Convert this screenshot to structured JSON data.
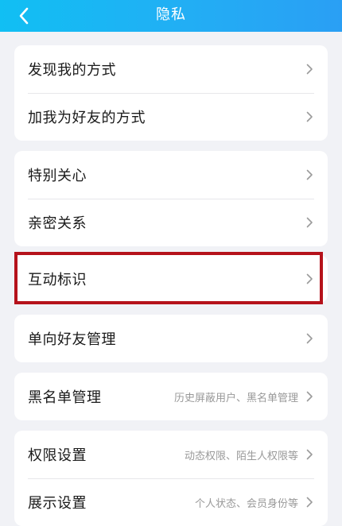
{
  "header": {
    "title": "隐私",
    "back_icon": "chevron-left-icon"
  },
  "groups": [
    {
      "items": [
        {
          "label": "发现我的方式"
        },
        {
          "label": "加我为好友的方式"
        }
      ]
    },
    {
      "items": [
        {
          "label": "特别关心"
        },
        {
          "label": "亲密关系"
        }
      ]
    },
    {
      "items": [
        {
          "label": "互动标识",
          "highlighted": true
        }
      ]
    },
    {
      "items": [
        {
          "label": "单向好友管理"
        }
      ]
    },
    {
      "items": [
        {
          "label": "黑名单管理",
          "value": "历史屏蔽用户、黑名单管理"
        }
      ]
    },
    {
      "items": [
        {
          "label": "权限设置",
          "value": "动态权限、陌生人权限等"
        },
        {
          "label": "展示设置",
          "value": "个人状态、会员身份等"
        }
      ]
    }
  ],
  "colors": {
    "header": "#1eb6f4",
    "highlight_border": "#b5121b",
    "background": "#f1f2f6"
  }
}
